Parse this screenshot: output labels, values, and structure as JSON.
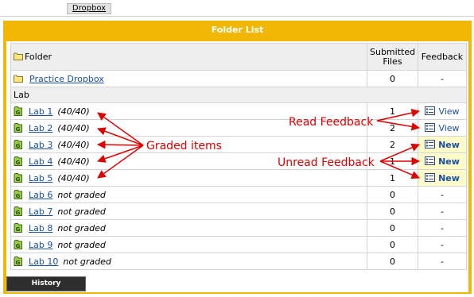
{
  "top_tab": {
    "label": "Dropbox"
  },
  "panel": {
    "title": "Folder List"
  },
  "headers": {
    "folder": "Folder",
    "submitted_line1": "Submitted",
    "submitted_line2": "Files",
    "feedback": "Feedback"
  },
  "practice": {
    "name": "Practice Dropbox",
    "submitted": "0",
    "feedback": "-"
  },
  "category": {
    "name": "Lab"
  },
  "labs": [
    {
      "name": "Lab 1",
      "score": "(40/40)",
      "submitted": "1",
      "feedback": "View",
      "status": "read"
    },
    {
      "name": "Lab 2",
      "score": "(40/40)",
      "submitted": "2",
      "feedback": "View",
      "status": "read"
    },
    {
      "name": "Lab 3",
      "score": "(40/40)",
      "submitted": "2",
      "feedback": "New",
      "status": "unread"
    },
    {
      "name": "Lab 4",
      "score": "(40/40)",
      "submitted": "1",
      "feedback": "New",
      "status": "unread"
    },
    {
      "name": "Lab 5",
      "score": "(40/40)",
      "submitted": "1",
      "feedback": "New",
      "status": "unread"
    },
    {
      "name": "Lab 6",
      "score": "not graded",
      "submitted": "0",
      "feedback": "-",
      "status": "none"
    },
    {
      "name": "Lab 7",
      "score": "not graded",
      "submitted": "0",
      "feedback": "-",
      "status": "none"
    },
    {
      "name": "Lab 8",
      "score": "not graded",
      "submitted": "0",
      "feedback": "-",
      "status": "none"
    },
    {
      "name": "Lab 9",
      "score": "not graded",
      "submitted": "0",
      "feedback": "-",
      "status": "none"
    },
    {
      "name": "Lab 10",
      "score": "not graded",
      "submitted": "0",
      "feedback": "-",
      "status": "none"
    }
  ],
  "history_button": {
    "label": "History"
  },
  "annotations": {
    "graded": "Graded items",
    "read": "Read Feedback",
    "unread": "Unread Feedback"
  },
  "icons": {
    "folder": "folder-icon",
    "graded": "graded-icon",
    "feedback": "feedback-icon"
  },
  "colors": {
    "accent": "#f2b705",
    "link": "#1a4fa0",
    "annotation": "#e00000",
    "unread_bg": "#fffccc"
  }
}
